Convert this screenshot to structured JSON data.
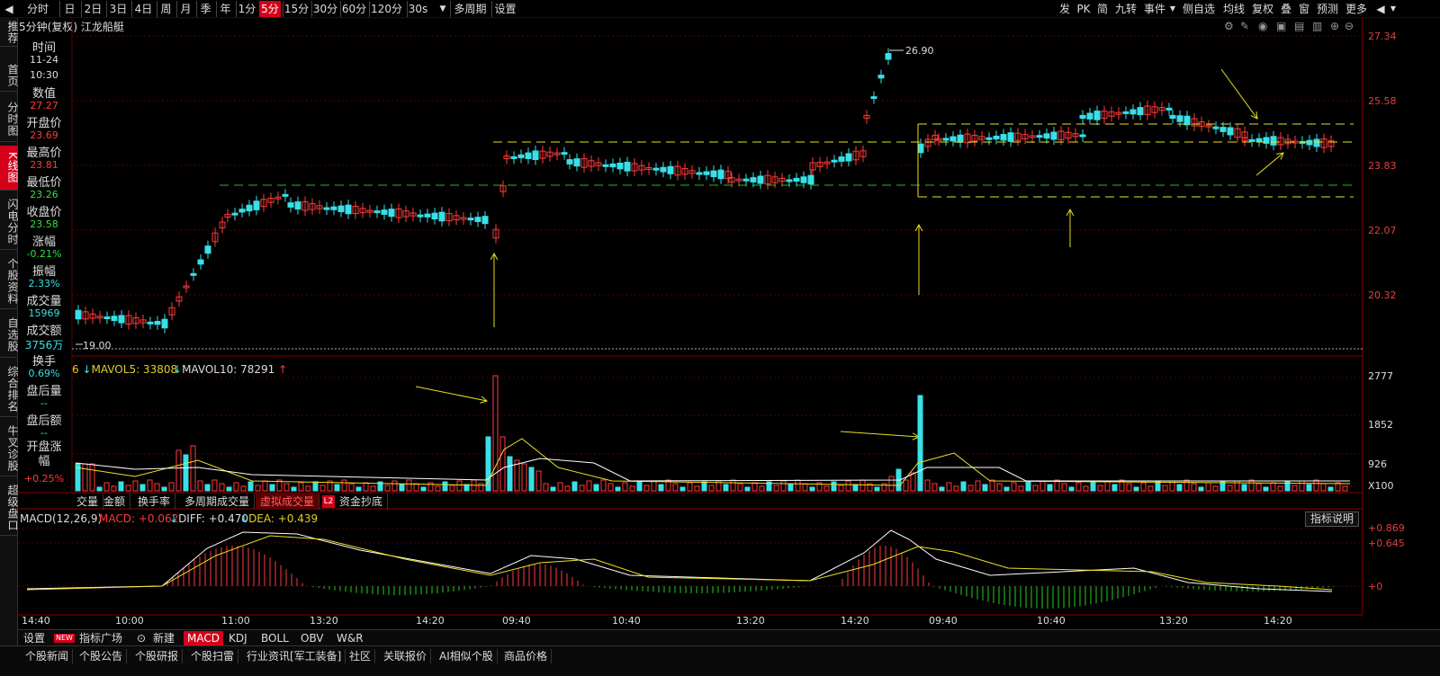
{
  "toolbar": {
    "items": [
      "分时",
      "日",
      "2日",
      "3日",
      "4日",
      "周",
      "月",
      "季",
      "年",
      "1分",
      "5分",
      "15分",
      "30分",
      "60分",
      "120分",
      "30s",
      "多周期",
      "设置"
    ],
    "selected": "5分",
    "right_items": [
      "发",
      "PK",
      "简",
      "九转",
      "事件",
      "侧自选",
      "均线",
      "复权",
      "叠",
      "窗",
      "预测",
      "更多"
    ]
  },
  "left_nav": [
    "推荐",
    "首页",
    "分时图",
    "K线图",
    "闪电分时",
    "个股资料",
    "自选股",
    "综合排名",
    "牛叉诊股",
    "超级盘口"
  ],
  "left_nav_selected": "K线图",
  "title": "5分钟(复权)  江龙船艇",
  "info": {
    "time_label": "时间",
    "date": "11-24",
    "time": "10:30",
    "value_label": "数值",
    "value": "27.27",
    "open_label": "开盘价",
    "open": "23.69",
    "high_label": "最高价",
    "high": "23.81",
    "low_label": "最低价",
    "low": "23.26",
    "close_label": "收盘价",
    "close": "23.58",
    "change_label": "涨幅",
    "change": "-0.21%",
    "amplitude_label": "振幅",
    "amplitude": "2.33%",
    "volume_label": "成交量",
    "volume": "15969",
    "turnover_label": "成交额",
    "turnover": "3756万",
    "turnover_rate_label": "换手",
    "turnover_rate": "0.69%",
    "after_vol_label": "盘后量",
    "after_vol": "--",
    "after_amt_label": "盘后额",
    "after_amt": "--",
    "open_change_label": "开盘涨幅",
    "open_change": "+0.25%"
  },
  "price_scale": [
    "27.34",
    "25.58",
    "23.83",
    "22.07",
    "20.32"
  ],
  "high_marker": "26.90",
  "low_marker": "19.00",
  "volume_legend": {
    "mavol5": "MAVOL5: 33808",
    "mavol10": "MAVOL10: 78291"
  },
  "volume_scale": [
    "2777",
    "1852",
    "926",
    "X100"
  ],
  "volume_tabs": [
    "交量",
    "金额",
    "换手率",
    "多周期成交量",
    "虚拟成交量",
    "资金抄底"
  ],
  "volume_tab_selected": "虚拟成交量",
  "volume_tab_badge": "L2",
  "macd_legend": {
    "name": "MACD(12,26,9)",
    "macd": "MACD: +0.062",
    "diff": "DIFF: +0.470",
    "dea": "DEA: +0.439"
  },
  "macd_button": "指标说明",
  "macd_scale": [
    "+0.869",
    "+0.645",
    "+0",
    "+0"
  ],
  "x_axis_labels": [
    "14:40",
    "10:00",
    "11:00",
    "13:20",
    "14:20",
    "09:40",
    "10:40",
    "13:20",
    "14:20",
    "09:40",
    "10:40",
    "13:20",
    "14:20"
  ],
  "bottom_tabs": [
    "设置",
    "NEW",
    "指标广场",
    "新建",
    "MACD",
    "KDJ",
    "BOLL",
    "OBV",
    "W&R"
  ],
  "bottom_tab_selected": "MACD",
  "news_tabs": [
    "个股新闻",
    "个股公告",
    "个股研报",
    "个股扫雷",
    "行业资讯[军工装备]",
    "社区",
    "关联报价",
    "AI相似个股",
    "商品价格"
  ],
  "colors": {
    "up": "#ff3a3a",
    "down": "#38e0e8",
    "ma_white": "#ffffff",
    "ma_yellow": "#f0e020",
    "grid": "#5a0000",
    "dash_yellow": "#e8e020",
    "dash_green": "#20c020"
  }
}
